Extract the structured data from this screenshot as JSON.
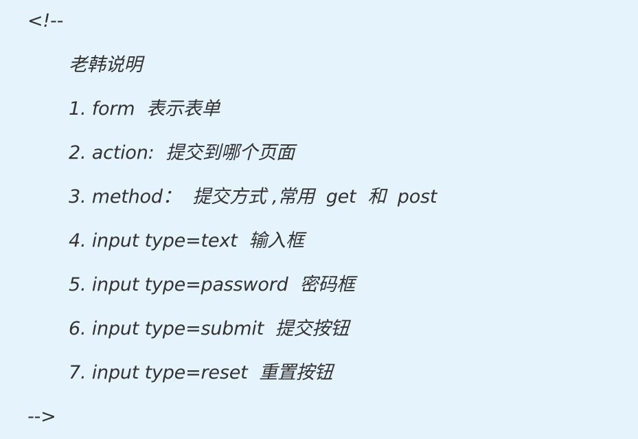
{
  "comment_block": {
    "open": "<!--",
    "lines": [
      "老韩说明",
      "1. form  表示表单",
      "2. action:  提交到哪个页面",
      "3. method：  提交方式 ,常用  get  和  post",
      "4. input type=text  输入框",
      "5. input type=password  密码框",
      "6. input type=submit  提交按钮",
      "7. input type=reset  重置按钮"
    ],
    "close": "-->"
  },
  "colors": {
    "background": "#e5f3fd",
    "text": "#333333"
  }
}
